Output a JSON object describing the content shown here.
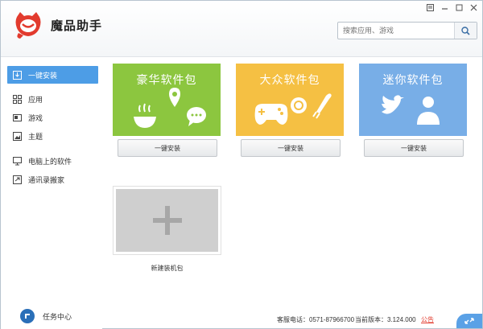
{
  "app": {
    "title": "魔品助手"
  },
  "search": {
    "placeholder": "搜索应用、游戏"
  },
  "sidebar": {
    "items": [
      {
        "label": "一键安装",
        "icon": "download-icon"
      },
      {
        "label": "应用",
        "icon": "apps-grid-icon"
      },
      {
        "label": "游戏",
        "icon": "gamepad-icon"
      },
      {
        "label": "主题",
        "icon": "theme-icon"
      },
      {
        "label": "电脑上的软件",
        "icon": "monitor-icon"
      },
      {
        "label": "通讯录搬家",
        "icon": "contacts-transfer-icon"
      }
    ],
    "task_center": "任务中心"
  },
  "packages": [
    {
      "title": "豪华软件包",
      "button": "一键安装",
      "color": "#8cc63f"
    },
    {
      "title": "大众软件包",
      "button": "一键安装",
      "color": "#f5c043"
    },
    {
      "title": "迷你软件包",
      "button": "一键安装",
      "color": "#78aee7"
    }
  ],
  "new_package": {
    "label": "新建装机包"
  },
  "footer": {
    "hotline": "客服电话：0571-87966700",
    "version": "当前版本：3.124.000",
    "notice": "公告"
  },
  "colors": {
    "accent": "#4d9de6",
    "brand_red": "#e23b2e"
  }
}
